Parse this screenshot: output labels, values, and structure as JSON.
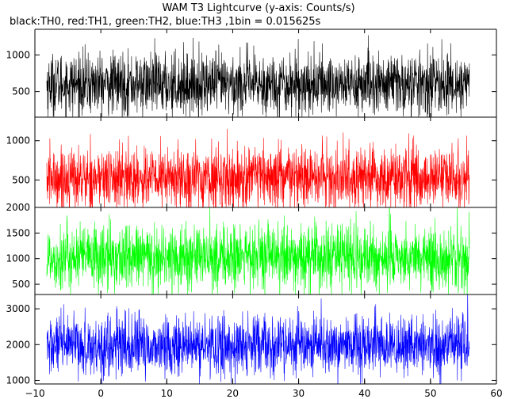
{
  "header": {
    "title": "WAM T3 Lightcurve (y-axis: Counts/s)",
    "subtitle": "black:TH0, red:TH1, green:TH2, blue:TH3 ,1bin = 0.015625s"
  },
  "chart_data": [
    {
      "type": "line",
      "series": [
        {
          "name": "TH0",
          "color": "#000000",
          "mean": 600,
          "std": 210,
          "x_start": -8.2,
          "x_end": 55.9
        }
      ],
      "xlim": [
        -10,
        60
      ],
      "ylim": [
        150,
        1350
      ],
      "yticks": [
        500,
        1000
      ],
      "ytick_labels": [
        "500",
        "1000"
      ]
    },
    {
      "type": "line",
      "series": [
        {
          "name": "TH1",
          "color": "#ff0000",
          "mean": 520,
          "std": 200,
          "x_start": -8.2,
          "x_end": 55.9
        }
      ],
      "xlim": [
        -10,
        60
      ],
      "ylim": [
        150,
        1300
      ],
      "yticks": [
        500,
        1000
      ],
      "ytick_labels": [
        "500",
        "1000"
      ]
    },
    {
      "type": "line",
      "series": [
        {
          "name": "TH2",
          "color": "#00ff00",
          "mean": 1020,
          "std": 320,
          "x_start": -8.2,
          "x_end": 55.9
        }
      ],
      "xlim": [
        -10,
        60
      ],
      "ylim": [
        300,
        2000
      ],
      "yticks": [
        500,
        1000,
        1500,
        2000
      ],
      "ytick_labels": [
        "500",
        "1000",
        "1500",
        "2000"
      ]
    },
    {
      "type": "line",
      "series": [
        {
          "name": "TH3",
          "color": "#0000ff",
          "mean": 1950,
          "std": 420,
          "x_start": -8.2,
          "x_end": 55.9
        }
      ],
      "xlim": [
        -10,
        60
      ],
      "ylim": [
        900,
        3400
      ],
      "yticks": [
        1000,
        2000,
        3000
      ],
      "ytick_labels": [
        "1000",
        "2000",
        "3000"
      ]
    }
  ],
  "x_axis": {
    "ticks": [
      -10,
      0,
      10,
      20,
      30,
      40,
      50,
      60
    ],
    "tick_labels": [
      "−10",
      "0",
      "10",
      "20",
      "30",
      "40",
      "50",
      "60"
    ]
  }
}
